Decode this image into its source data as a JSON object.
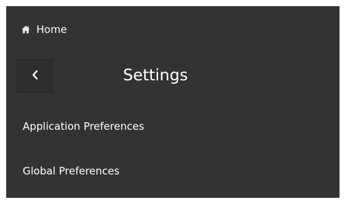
{
  "nav": {
    "home_label": "Home",
    "home_icon": "home-icon",
    "back_icon": "chevron-left-icon"
  },
  "header": {
    "title": "Settings"
  },
  "menu": {
    "items": [
      {
        "label": "Application Preferences"
      },
      {
        "label": "Global Preferences"
      }
    ]
  },
  "colors": {
    "panel_bg": "#333333",
    "text": "#ffffff"
  }
}
